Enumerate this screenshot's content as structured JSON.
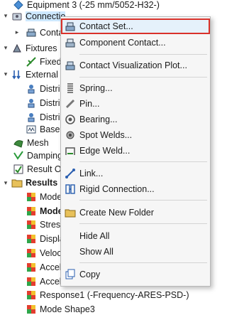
{
  "tree": {
    "equipment": "Equipment 3 (-25 mm/5052-H32-)",
    "connections": "Connectio",
    "contact": "Conta",
    "fixtures": "Fixtures",
    "fixed": "Fixed-",
    "external_loads": "External L",
    "distrib1": "Distri",
    "distrib2": "Distri",
    "distrib3": "Distri",
    "base": "Base",
    "mesh": "Mesh",
    "damping": "Damping",
    "result_options": "Result Op",
    "results": "Results",
    "mode1": "Mode",
    "mode2": "Mode",
    "stress": "Stress",
    "displacement": "Displa",
    "velocity": "Veloc",
    "accel1": "Accele",
    "accel2": "Accel",
    "response": "Response1 (-Frequency-ARES-PSD-)",
    "mode_shape3": "Mode Shape3"
  },
  "menu": {
    "contact_set": "Contact Set...",
    "component_contact": "Component Contact...",
    "contact_vis": "Contact Visualization Plot...",
    "spring": "Spring...",
    "pin": "Pin...",
    "bearing": "Bearing...",
    "spot_welds": "Spot Welds...",
    "edge_weld": "Edge Weld...",
    "link": "Link...",
    "rigid": "Rigid Connection...",
    "new_folder": "Create New Folder",
    "hide_all": "Hide All",
    "show_all": "Show All",
    "copy": "Copy"
  },
  "colors": {
    "highlight_border": "#d9312a",
    "selection": "#cde8ff"
  }
}
